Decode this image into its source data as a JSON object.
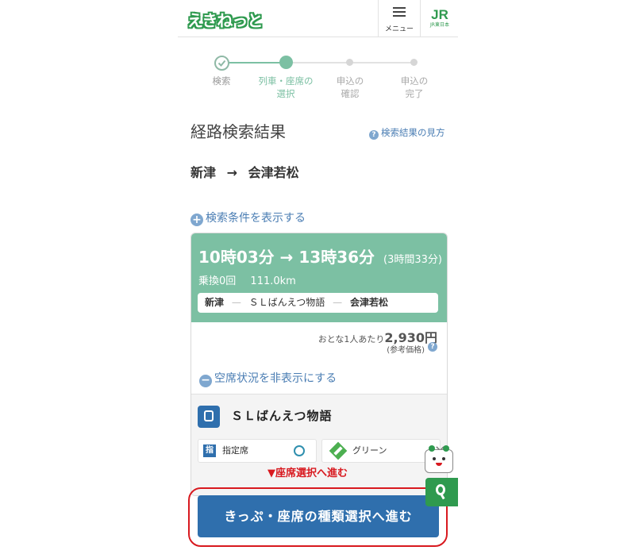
{
  "header": {
    "logo": "えきねっと",
    "menu_label": "メニュー",
    "brand_mark": "JR",
    "brand_sub": "JR東日本"
  },
  "stepper": {
    "steps": [
      {
        "label": "検索",
        "state": "done"
      },
      {
        "label": "列車・座席の選択",
        "line1": "列車・座席の",
        "line2": "選択",
        "state": "current"
      },
      {
        "label": "申込の確認",
        "line1": "申込の",
        "line2": "確認",
        "state": "todo"
      },
      {
        "label": "申込の完了",
        "line1": "申込の",
        "line2": "完了",
        "state": "todo"
      }
    ]
  },
  "page": {
    "title": "経路検索結果",
    "help_link": "検索結果の見方",
    "route_from": "新津",
    "route_arrow": "→",
    "route_to": "会津若松",
    "show_conditions": "検索条件を表示する"
  },
  "result": {
    "depart": "10時03分",
    "arrow": "→",
    "arrive": "13時36分",
    "duration": "(3時間33分)",
    "transfers": "乗換0回",
    "distance": "111.0km",
    "segment_from": "新津",
    "segment_train": "ＳＬばんえつ物語",
    "segment_to": "会津若松",
    "price_prefix": "おとな1人あたり",
    "price": "2,930円",
    "price_note": "(参考価格)",
    "hide_availability": "空席状況を非表示にする",
    "train_name": "ＳＬばんえつ物語",
    "seats": [
      {
        "tag": "指",
        "label": "指定席",
        "availability": "○"
      },
      {
        "label": "グリーン",
        "availability": "×"
      }
    ],
    "advance_label": "▼座席選択へ進む",
    "cta_label": "きっぷ・座席の種類選択へ進む"
  },
  "colors": {
    "accent": "#7cc0a3",
    "brand_green": "#2f9a4f",
    "button_blue": "#2f6fad",
    "alert_red": "#d8191f",
    "link": "#4a7db3"
  }
}
